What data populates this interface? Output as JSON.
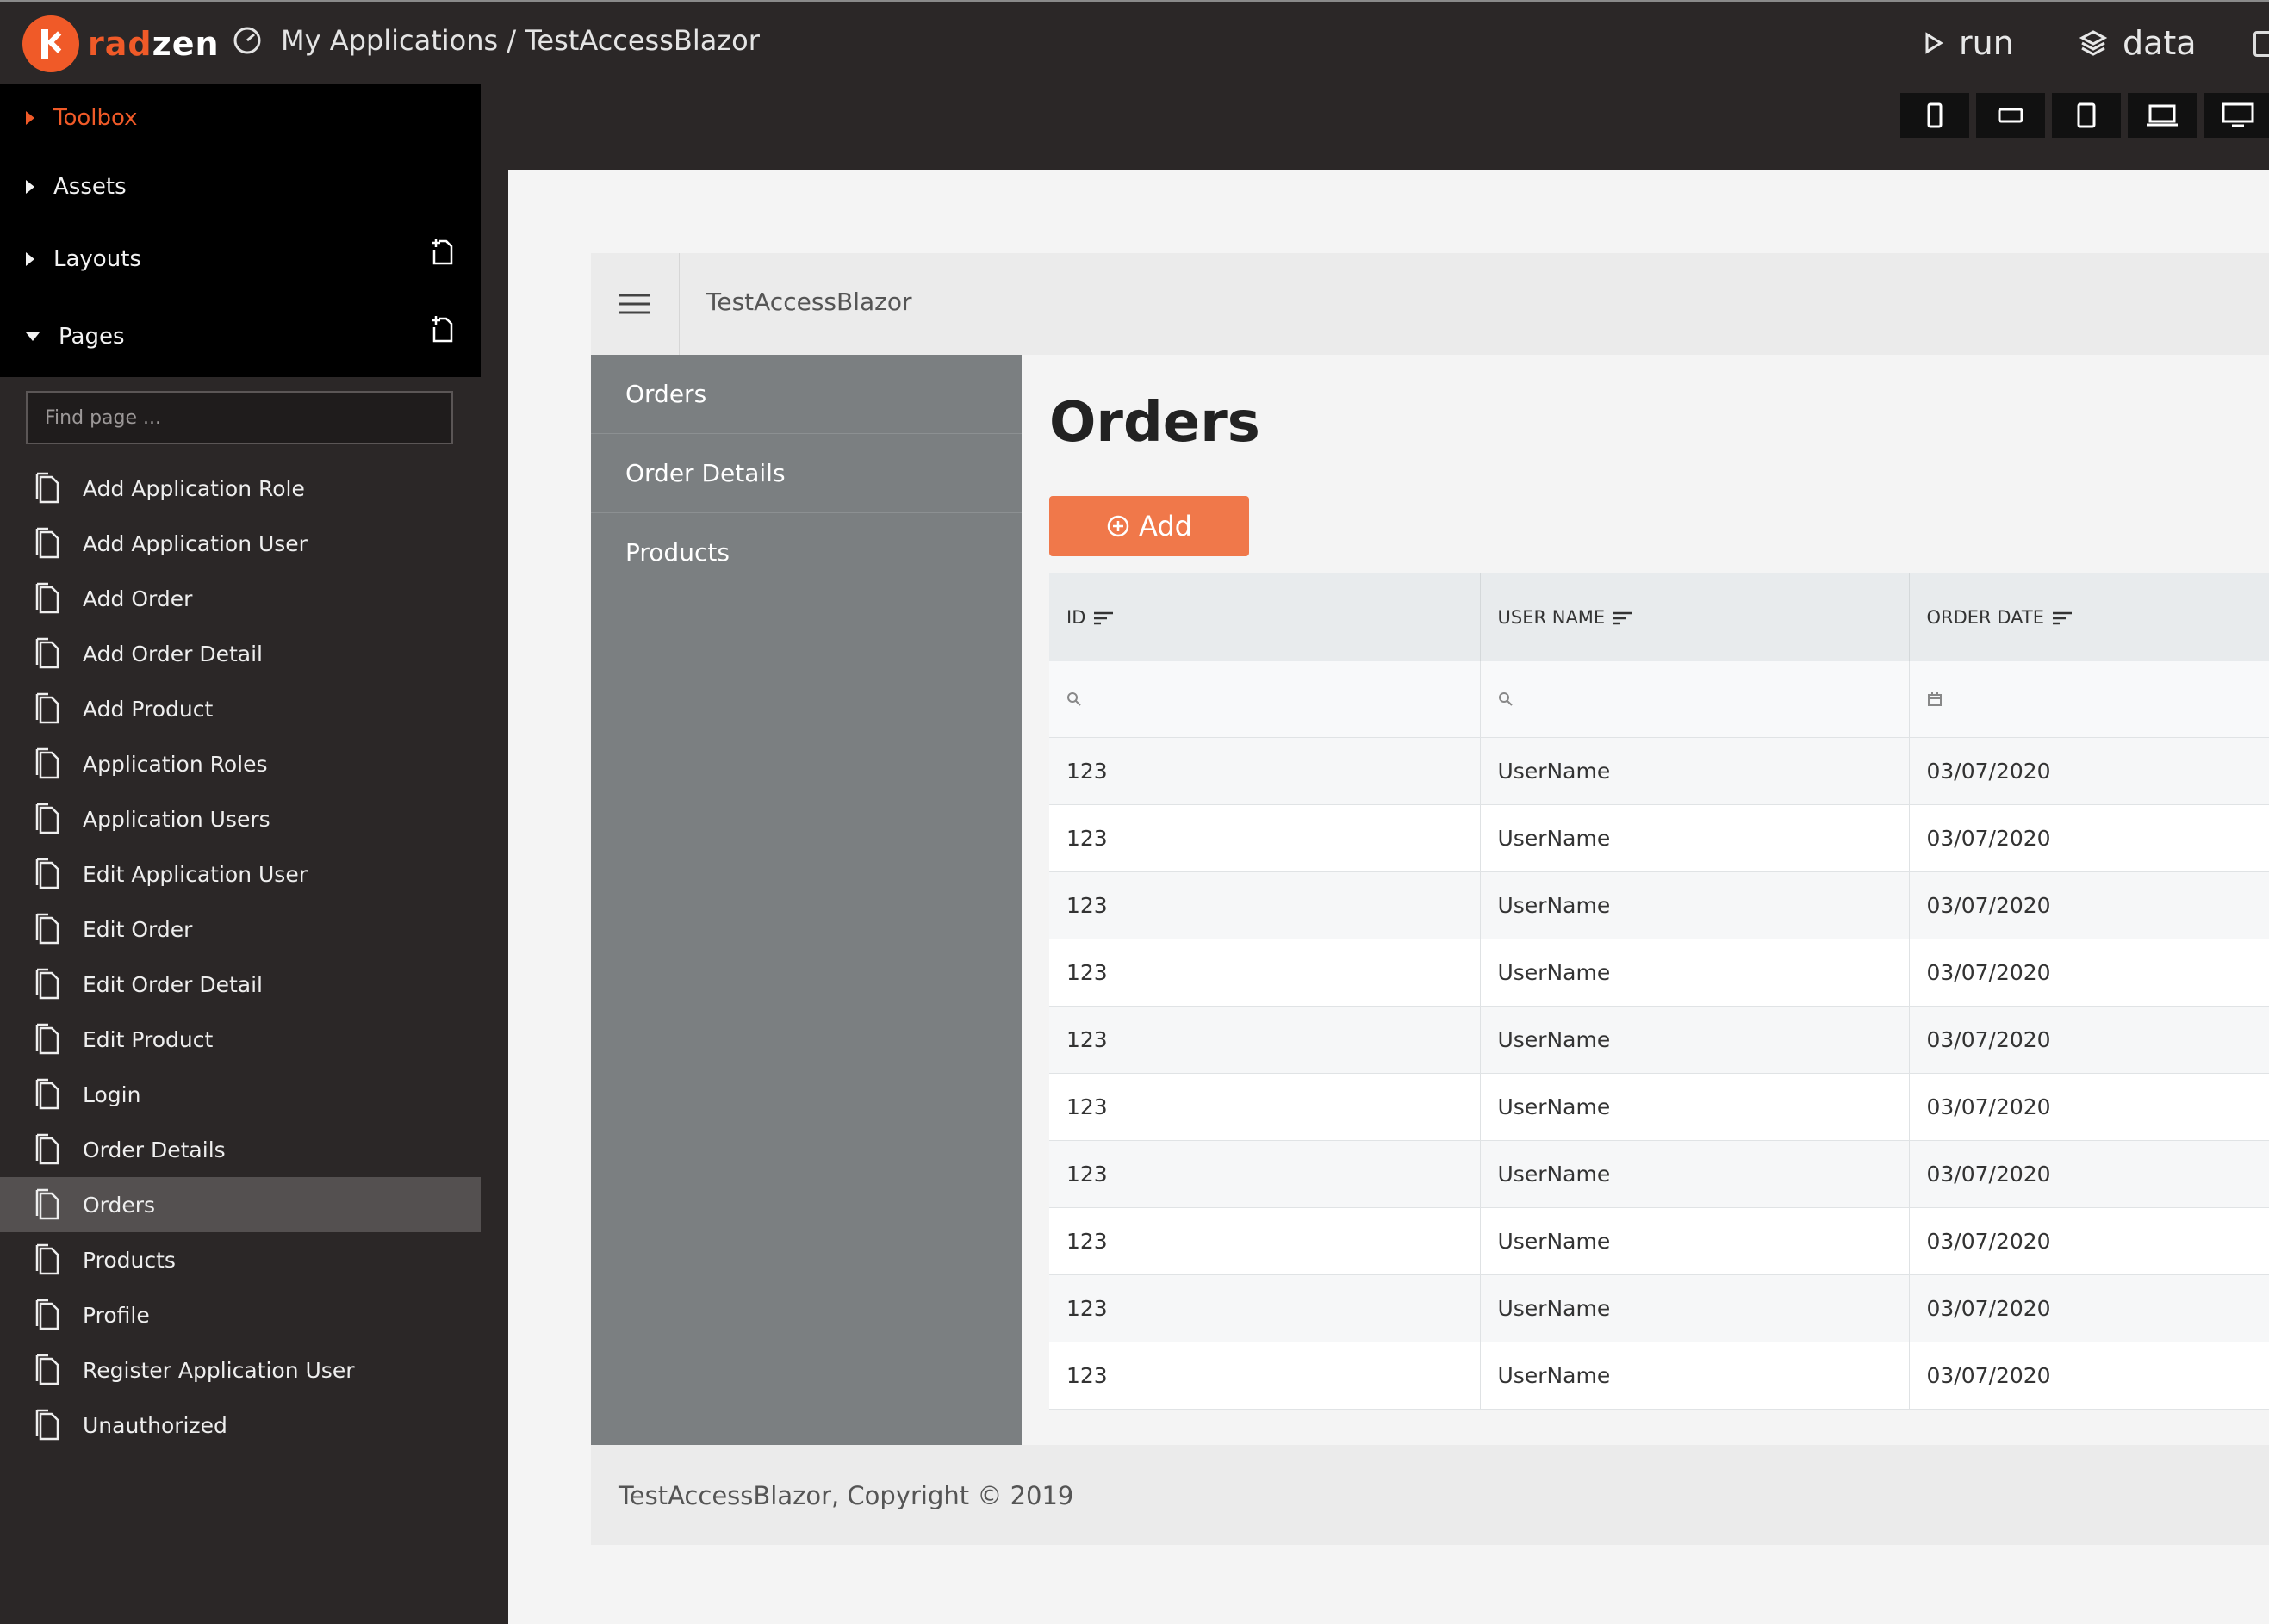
{
  "app": {
    "brand_rad": "rad",
    "brand_zen": "zen",
    "breadcrumb": "My Applications / TestAccessBlazor"
  },
  "top_actions": {
    "run_label": "run",
    "data_label": "data"
  },
  "sidebar": {
    "sections": {
      "toolbox": "Toolbox",
      "assets": "Assets",
      "layouts": "Layouts",
      "pages": "Pages"
    },
    "search_placeholder": "Find page ...",
    "pages": [
      "Add Application Role",
      "Add Application User",
      "Add Order",
      "Add Order Detail",
      "Add Product",
      "Application Roles",
      "Application Users",
      "Edit Application User",
      "Edit Order",
      "Edit Order Detail",
      "Edit Product",
      "Login",
      "Order Details",
      "Orders",
      "Products",
      "Profile",
      "Register Application User",
      "Unauthorized"
    ],
    "selected_page": "Orders"
  },
  "preview": {
    "header_title": "TestAccessBlazor",
    "nav": [
      "Orders",
      "Order Details",
      "Products"
    ],
    "page_title": "Orders",
    "add_label": "Add",
    "grid": {
      "columns": [
        "ID",
        "USER NAME",
        "ORDER DATE"
      ],
      "rows": [
        [
          "123",
          "UserName",
          "03/07/2020"
        ],
        [
          "123",
          "UserName",
          "03/07/2020"
        ],
        [
          "123",
          "UserName",
          "03/07/2020"
        ],
        [
          "123",
          "UserName",
          "03/07/2020"
        ],
        [
          "123",
          "UserName",
          "03/07/2020"
        ],
        [
          "123",
          "UserName",
          "03/07/2020"
        ],
        [
          "123",
          "UserName",
          "03/07/2020"
        ],
        [
          "123",
          "UserName",
          "03/07/2020"
        ],
        [
          "123",
          "UserName",
          "03/07/2020"
        ],
        [
          "123",
          "UserName",
          "03/07/2020"
        ]
      ]
    },
    "footer": "TestAccessBlazor, Copyright © 2019"
  },
  "colors": {
    "accent": "#f05a28",
    "button": "#f0784a",
    "nav_bg": "#7b7f81"
  },
  "icons": [
    "gauge-icon",
    "play-icon",
    "layers-icon",
    "file-icon",
    "add-page-icon",
    "hamburger-icon",
    "search-icon",
    "calendar-icon",
    "sort-icon",
    "plus-circle-icon",
    "phone-icon",
    "tablet-icon",
    "laptop-icon",
    "monitor-icon"
  ]
}
